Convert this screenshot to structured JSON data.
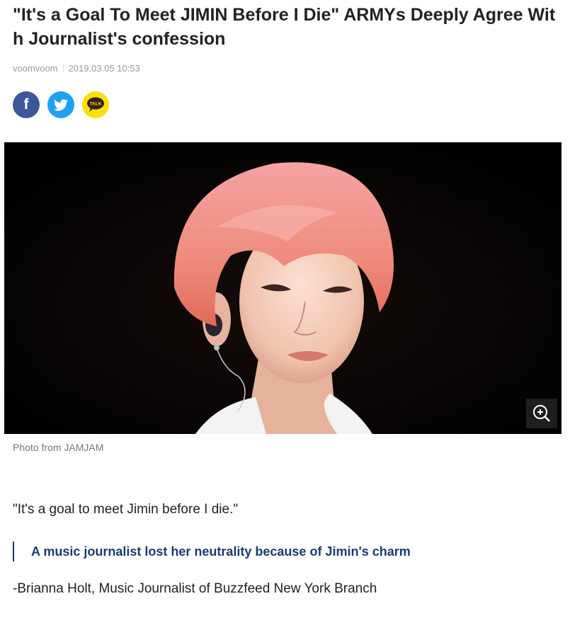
{
  "article": {
    "headline": "\"It's a Goal To Meet JIMIN Before I Die\" ARMYs Deeply Agree With Journalist's confession",
    "author": "voomvoom",
    "date": "2019.03.05 10:53"
  },
  "share": {
    "facebook_icon": "f",
    "twitter_icon": "twitter-bird",
    "kakao_label": "TALK"
  },
  "photo": {
    "caption": "Photo from JAMJAM",
    "zoom_icon": "zoom-in-icon"
  },
  "body": {
    "quote": "\"It's a goal to meet Jimin before I die.\"",
    "subheading": "A music journalist lost her neutrality because of Jimin's charm",
    "byline": "-Brianna Holt, Music Journalist of Buzzfeed New York Branch"
  },
  "colors": {
    "facebook": "#3b5998",
    "twitter": "#1da1f2",
    "kakao": "#fae100",
    "subhead_accent": "#173c6d"
  }
}
